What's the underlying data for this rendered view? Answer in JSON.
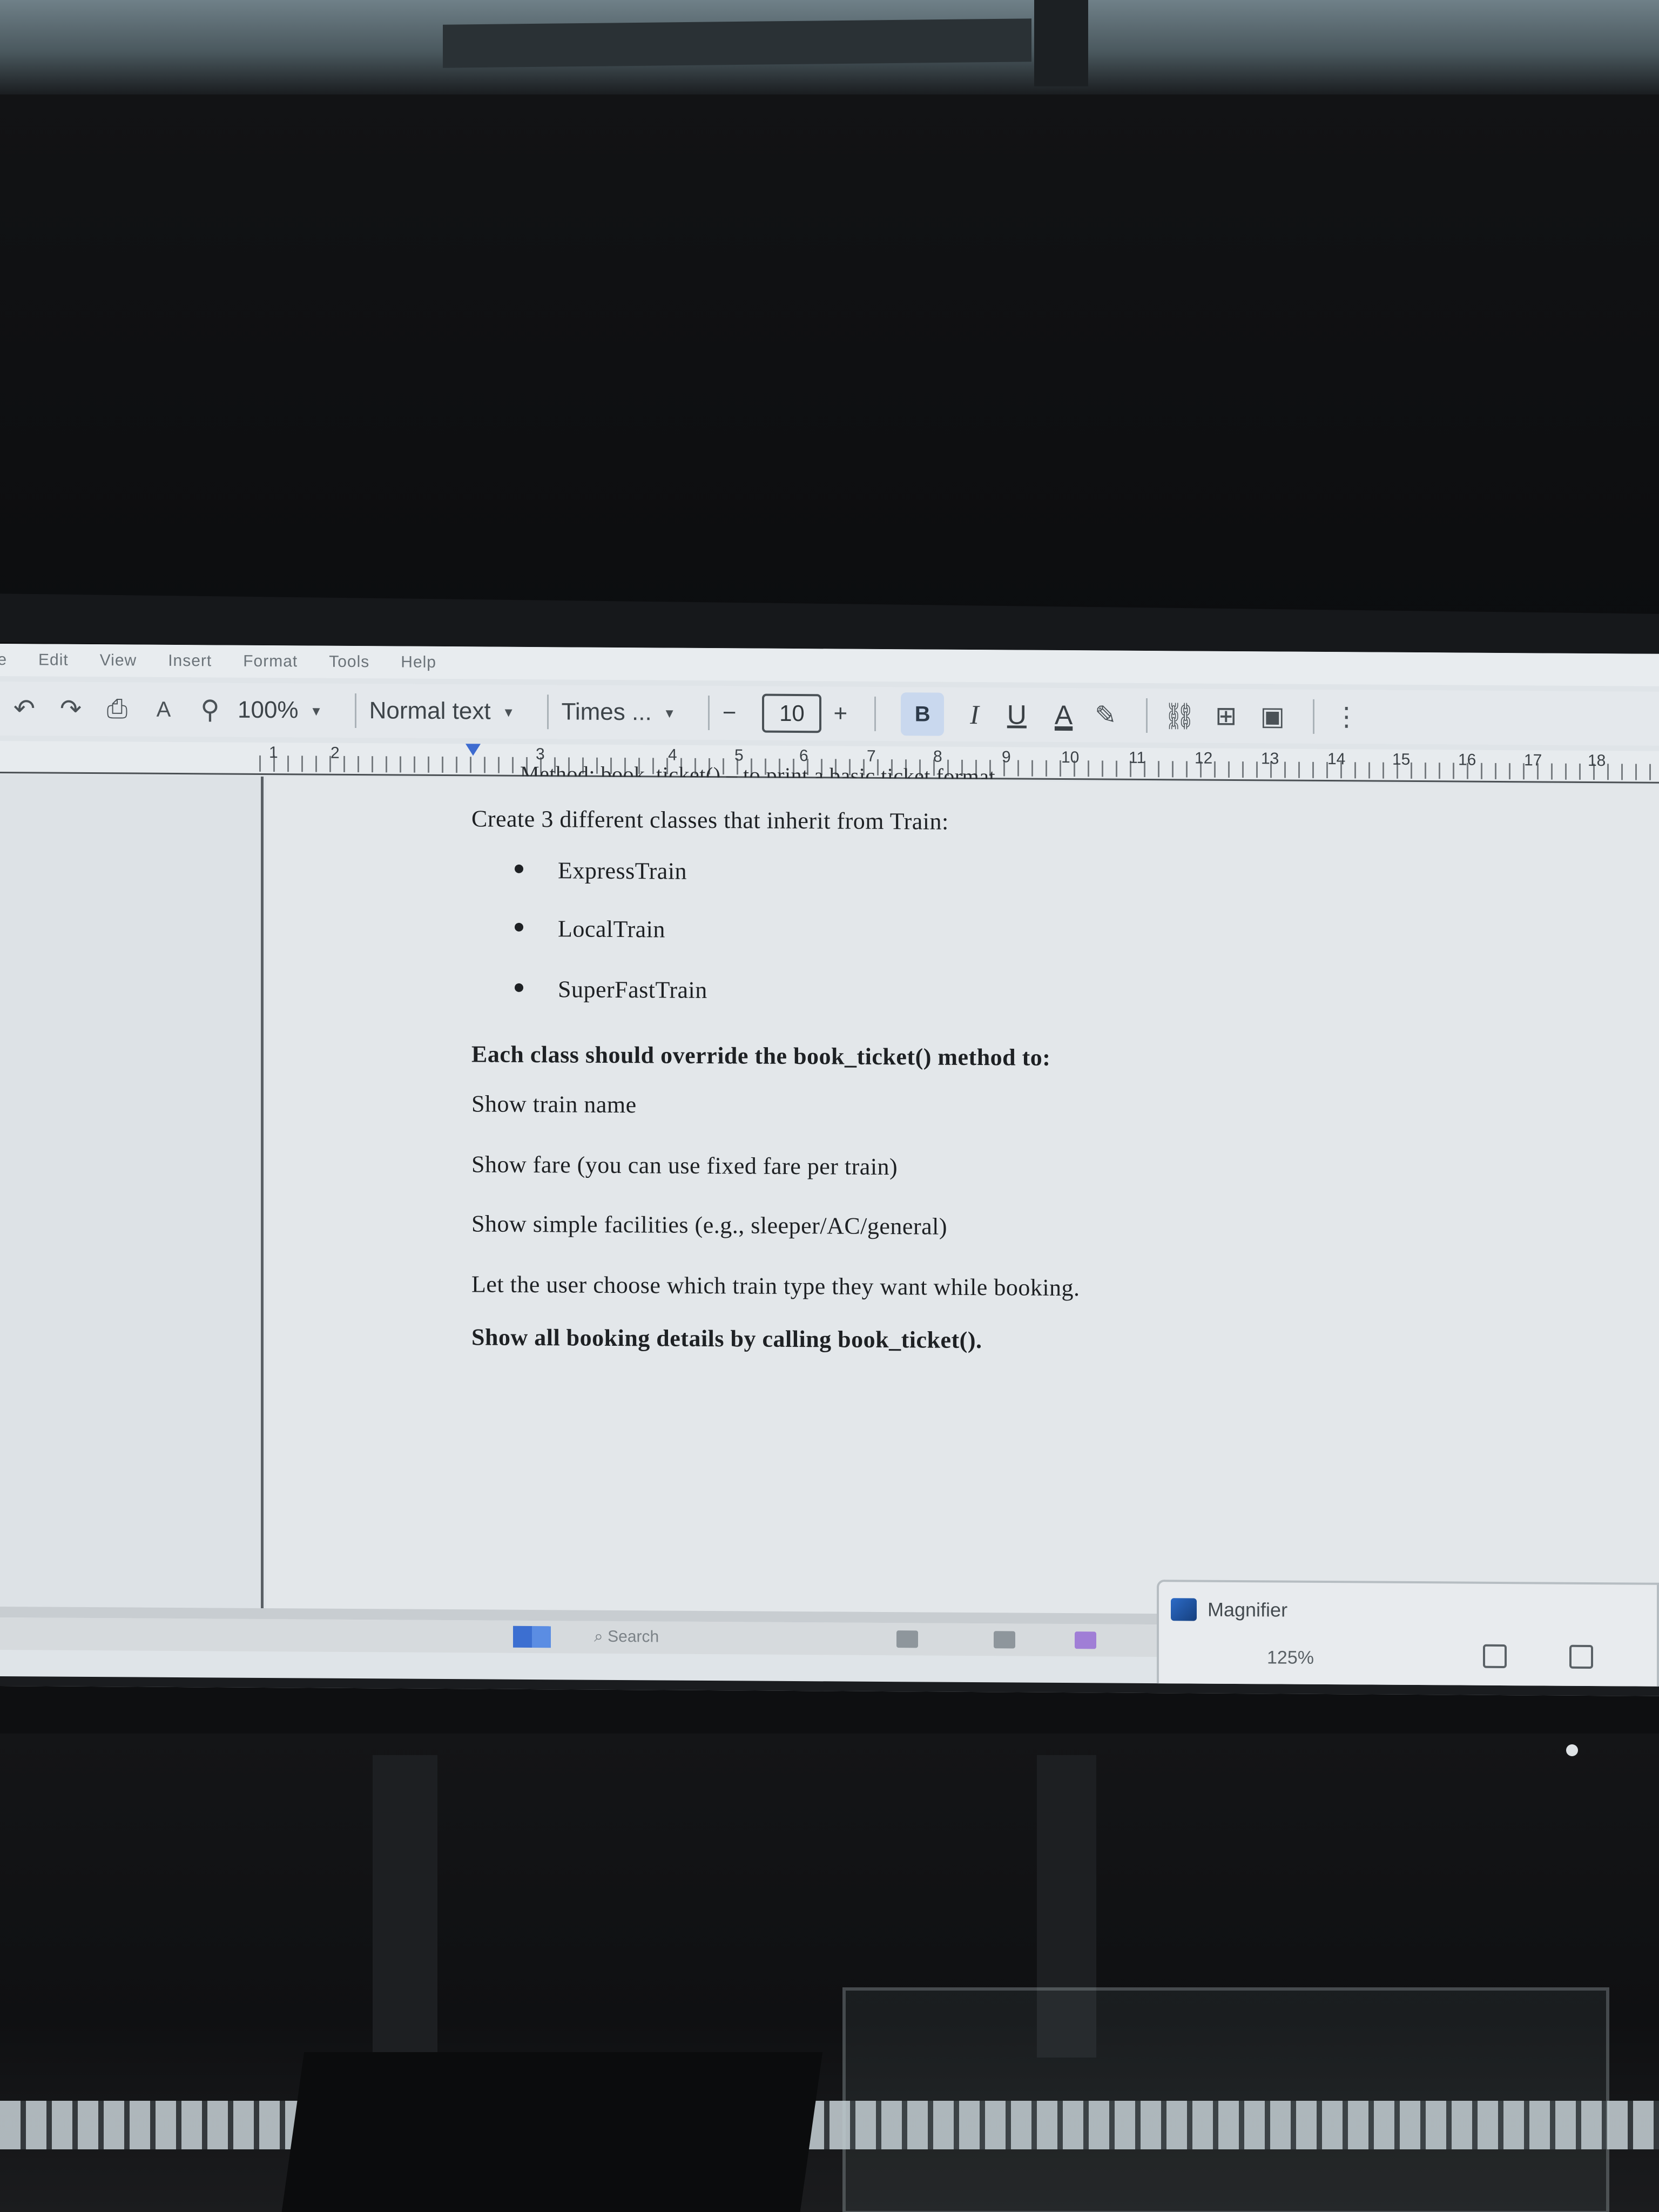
{
  "menu": [
    "ile",
    "Edit",
    "View",
    "Insert",
    "Format",
    "Tools",
    "Help"
  ],
  "toolbar": {
    "zoom": "100%",
    "style": "Normal text",
    "font": "Times ...",
    "font_size": "10",
    "minus": "−",
    "plus": "+",
    "bold": "B",
    "italic": "I",
    "underline": "U",
    "text_color": "A"
  },
  "ruler_numbers": [
    "1",
    "2",
    "3",
    "4",
    "5",
    "6",
    "7",
    "8",
    "9",
    "10",
    "11",
    "12",
    "13",
    "14",
    "15",
    "16",
    "17",
    "18"
  ],
  "document": {
    "cut_line": "Method: book_ticket() – to print a basic ticket format",
    "intro": "Create 3 different classes that inherit from Train:",
    "classes": [
      "ExpressTrain",
      "LocalTrain",
      "SuperFastTrain"
    ],
    "override": "Each class should override the book_ticket() method to:",
    "requirements": [
      "Show train name",
      "Show fare (you can use fixed fare per train)",
      "Show simple facilities (e.g., sleeper/AC/general)",
      "Let the user choose which train type they want while booking.",
      "Show all booking details by calling book_ticket()."
    ]
  },
  "taskbar": {
    "search": "Search"
  },
  "magnifier": {
    "title": "Magnifier",
    "zoom": "125%"
  }
}
